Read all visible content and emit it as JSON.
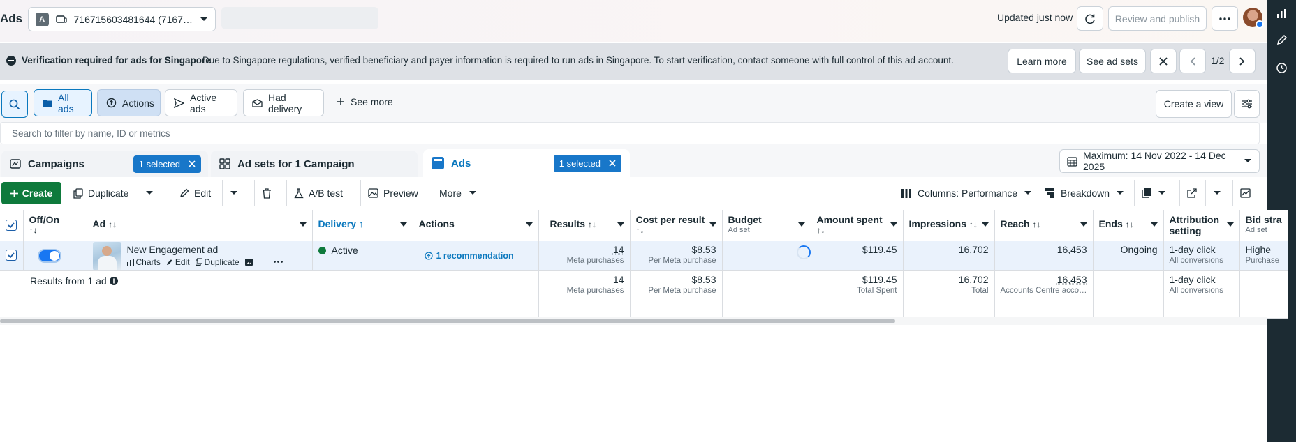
{
  "header": {
    "title": "Ads",
    "account_badge": "A",
    "account_name": "716715603481644 (7167…",
    "updated": "Updated just now",
    "review_publish": "Review and publish"
  },
  "banner": {
    "title": "Verification required for ads for Singapore",
    "message": "Due to Singapore regulations, verified beneficiary and payer information is required to run ads in Singapore. To start verification, contact someone with full control of this ad account.",
    "learn_more": "Learn more",
    "see_ad_sets": "See ad sets",
    "pager": "1/2"
  },
  "filters": {
    "all_ads": "All ads",
    "actions": "Actions",
    "active_ads": "Active ads",
    "had_delivery": "Had delivery",
    "see_more": "See more",
    "create_view": "Create a view"
  },
  "search": {
    "placeholder": "Search to filter by name, ID or metrics"
  },
  "tabs": {
    "campaigns": "Campaigns",
    "campaigns_selected": "1 selected",
    "adsets": "Ad sets for 1 Campaign",
    "ads": "Ads",
    "ads_selected": "1 selected",
    "date_range": "Maximum: 14 Nov 2022 - 14 Dec 2025"
  },
  "toolbar": {
    "create": "Create",
    "duplicate": "Duplicate",
    "edit": "Edit",
    "ab_test": "A/B test",
    "preview": "Preview",
    "more": "More",
    "columns": "Columns: Performance",
    "breakdown": "Breakdown"
  },
  "table": {
    "headers": {
      "offon": "Off/On",
      "ad": "Ad",
      "delivery": "Delivery",
      "actions": "Actions",
      "results": "Results",
      "cpr": "Cost per result",
      "budget": "Budget",
      "budget_sub": "Ad set",
      "amount": "Amount spent",
      "impressions": "Impressions",
      "reach": "Reach",
      "ends": "Ends",
      "attribution": "Attribution setting",
      "bid": "Bid stra",
      "bid_sub": "Ad set"
    },
    "row": {
      "ad_name": "New Engagement ad",
      "charts": "Charts",
      "edit": "Edit",
      "duplicate": "Duplicate",
      "delivery": "Active",
      "actions": "1 recommendation",
      "results": "14",
      "results_sub": "Meta purchases",
      "cpr": "$8.53",
      "cpr_sub": "Per Meta purchase",
      "amount": "$119.45",
      "impressions": "16,702",
      "reach": "16,453",
      "ends": "Ongoing",
      "attribution": "1-day click",
      "attribution_sub": "All conversions",
      "bid": "Highe",
      "bid_sub": "Purchase"
    },
    "total": {
      "label": "Results from 1 ad",
      "results": "14",
      "results_sub": "Meta purchases",
      "cpr": "$8.53",
      "cpr_sub": "Per Meta purchase",
      "amount": "$119.45",
      "amount_sub": "Total Spent",
      "impressions": "16,702",
      "impressions_sub": "Total",
      "reach": "16,453",
      "reach_sub": "Accounts Centre acco…",
      "attribution": "1-day click",
      "attribution_sub": "All conversions"
    }
  },
  "colors": {
    "accent": "#0a78be",
    "create_green": "#0e7a3c",
    "selected_row": "#eaf2fc",
    "rail": "#1c2b33"
  }
}
